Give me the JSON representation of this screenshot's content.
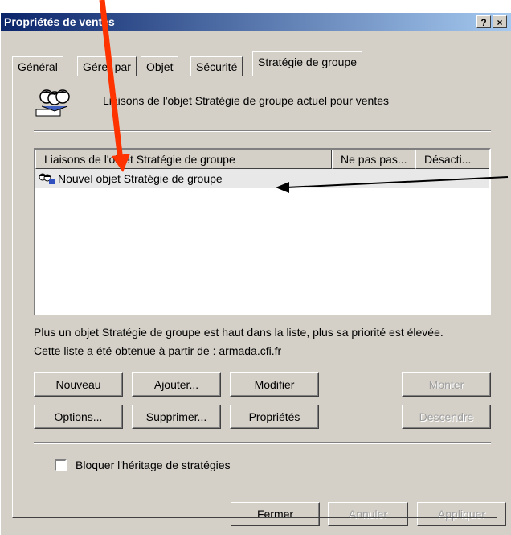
{
  "window": {
    "title": "Propriétés de ventes",
    "help_button": "?",
    "close_button": "×"
  },
  "tabs": [
    {
      "label": "Général"
    },
    {
      "label": "Gérer par"
    },
    {
      "label": "Objet"
    },
    {
      "label": "Sécurité"
    },
    {
      "label": "Stratégie de groupe",
      "active": true
    }
  ],
  "header": {
    "text": "Liaisons de l'objet Stratégie de groupe actuel pour ventes",
    "icon": "users-group-icon"
  },
  "list": {
    "columns": [
      "Liaisons de l'objet Stratégie de groupe",
      "Ne pas pas...",
      "Désacti..."
    ],
    "rows": [
      {
        "name": "Nouvel objet Stratégie de groupe",
        "icon": "gpo-icon"
      }
    ]
  },
  "info": {
    "line1": "Plus un objet Stratégie de groupe est haut dans la liste, plus sa priorité est élevée.",
    "line2": "Cette liste a été obtenue à partir de : armada.cfi.fr"
  },
  "buttons": {
    "nouveau": "Nouveau",
    "ajouter": "Ajouter...",
    "modifier": "Modifier",
    "monter": "Monter",
    "options": "Options...",
    "supprimer": "Supprimer...",
    "proprietes": "Propriétés",
    "descendre": "Descendre"
  },
  "checkbox": {
    "label": "Bloquer l'héritage de stratégies",
    "checked": false
  },
  "footer": {
    "fermer": "Fermer",
    "annuler": "Annuler",
    "appliquer": "Appliquer"
  },
  "colors": {
    "annotation_arrow": "#ff3300",
    "title_bar_start": "#0a246a",
    "title_bar_end": "#a6caf0"
  }
}
